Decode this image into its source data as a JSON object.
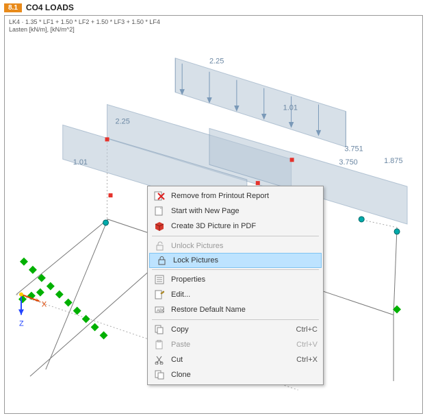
{
  "header": {
    "badge": "8.1",
    "title": "CO4 LOADS"
  },
  "subtitle": {
    "line1": "LK4 · 1.35 * LF1 + 1.50 * LF2 + 1.50 * LF3 + 1.50 * LF4",
    "line2": "Lasten [kN/m], [kN/m^2]"
  },
  "dimensions": {
    "d1": "2.25",
    "d2": "1.01",
    "d3": "2.25",
    "d4": "1.01",
    "d5": "3.751",
    "d6": "1.875",
    "d7": "3.750"
  },
  "axes": {
    "x": "X",
    "z": "Z"
  },
  "menu": {
    "items": [
      {
        "label": "Remove from Printout Report",
        "shortcut": "",
        "enabled": true,
        "icon": "remove-report-icon"
      },
      {
        "label": "Start with New Page",
        "shortcut": "",
        "enabled": true,
        "icon": "new-page-icon"
      },
      {
        "label": "Create 3D Picture in PDF",
        "shortcut": "",
        "enabled": true,
        "icon": "cube-3d-icon"
      },
      {
        "sep": true
      },
      {
        "label": "Unlock Pictures",
        "shortcut": "",
        "enabled": false,
        "icon": "unlock-icon"
      },
      {
        "label": "Lock Pictures",
        "shortcut": "",
        "enabled": true,
        "icon": "lock-icon",
        "highlight": true
      },
      {
        "sep": true
      },
      {
        "label": "Properties",
        "shortcut": "",
        "enabled": true,
        "icon": "properties-icon"
      },
      {
        "label": "Edit...",
        "shortcut": "",
        "enabled": true,
        "icon": "edit-icon"
      },
      {
        "label": "Restore Default Name",
        "shortcut": "",
        "enabled": true,
        "icon": "restore-name-icon"
      },
      {
        "sep": true
      },
      {
        "label": "Copy",
        "shortcut": "Ctrl+C",
        "enabled": true,
        "icon": "copy-icon"
      },
      {
        "label": "Paste",
        "shortcut": "Ctrl+V",
        "enabled": false,
        "icon": "paste-icon"
      },
      {
        "label": "Cut",
        "shortcut": "Ctrl+X",
        "enabled": true,
        "icon": "cut-icon"
      },
      {
        "label": "Clone",
        "shortcut": "",
        "enabled": true,
        "icon": "clone-icon"
      }
    ]
  }
}
